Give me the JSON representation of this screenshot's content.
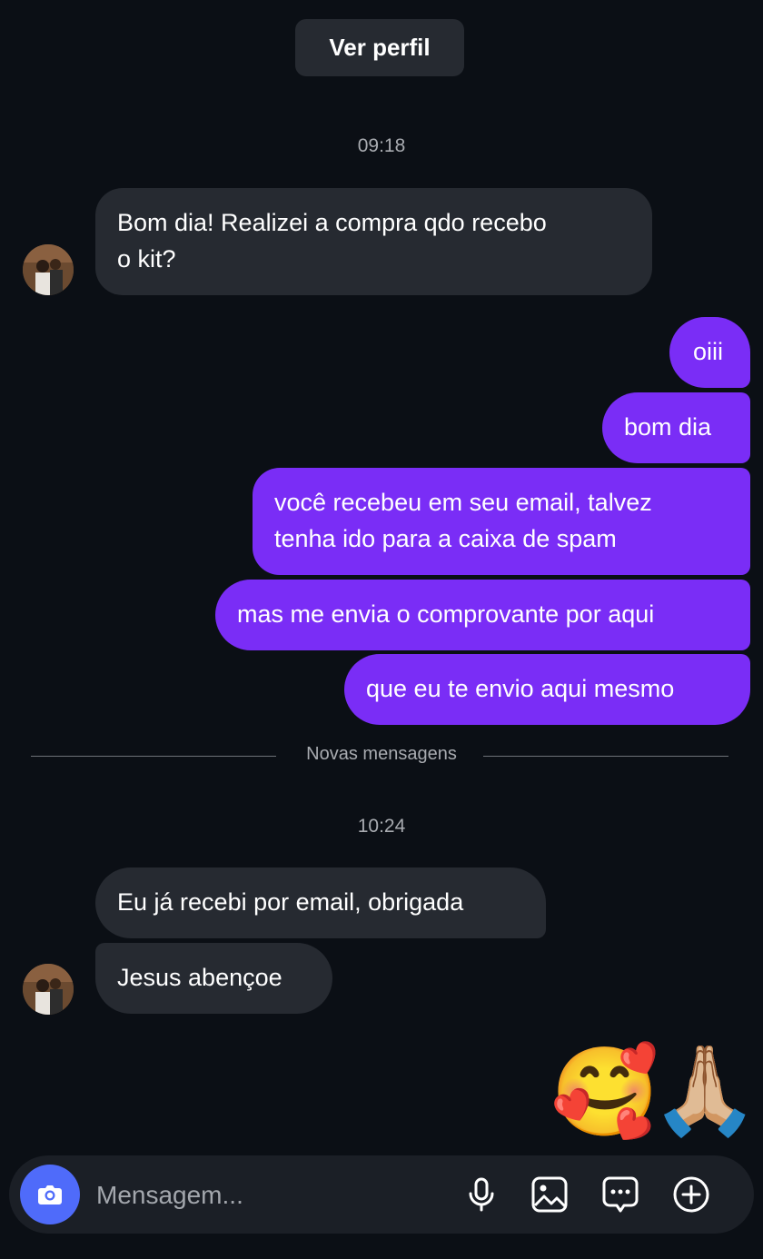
{
  "header": {
    "view_profile_label": "Ver perfil"
  },
  "timestamps": {
    "first": "09:18",
    "second": "10:24"
  },
  "messages": {
    "received_1": [
      "Bom dia! Realizei a compra qdo recebo",
      "o kit?"
    ],
    "sent_1": "oiii",
    "sent_2": "bom dia",
    "sent_3": [
      "você recebeu em seu email, talvez",
      "tenha ido para a caixa de spam"
    ],
    "sent_4": "mas me envia o comprovante por aqui",
    "sent_5": "que eu te envio aqui mesmo",
    "received_2": "Eu já recebi por email, obrigada",
    "received_3": "Jesus abençoe"
  },
  "divider_label": "Novas mensagens",
  "reactions": {
    "smile_hearts": "🥰",
    "praying_hands": "🙏🏼"
  },
  "composer": {
    "placeholder": "Mensagem...",
    "icons": [
      "camera-icon",
      "microphone-icon",
      "image-icon",
      "sticker-icon",
      "plus-icon"
    ]
  },
  "colors": {
    "background": "#0b0f15",
    "incoming_bubble": "#262a31",
    "outgoing_bubble": "#7a2df6",
    "camera_button": "#4f6bfa"
  }
}
